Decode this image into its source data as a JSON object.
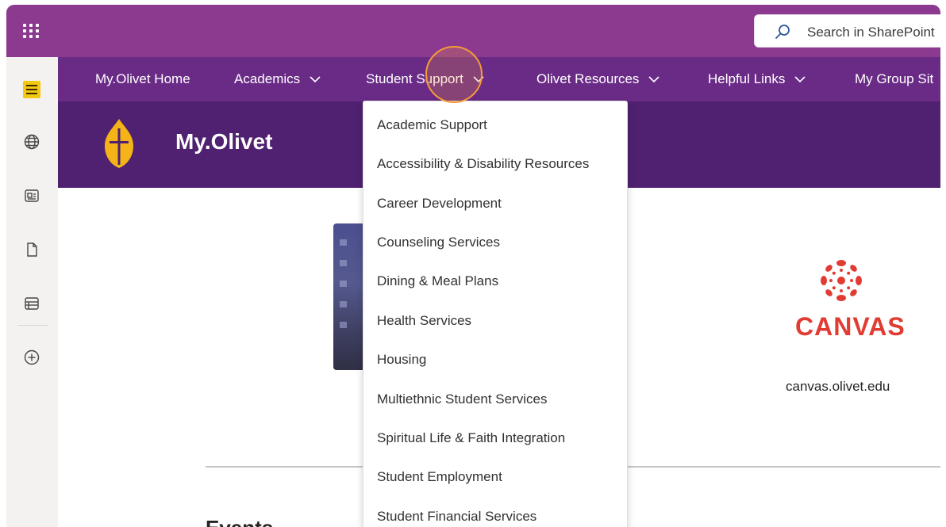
{
  "suitebar": {
    "search_placeholder": "Search in SharePoint"
  },
  "hubnav": {
    "items": [
      {
        "label": "My.Olivet Home"
      },
      {
        "label": "Academics"
      },
      {
        "label": "Student Support"
      },
      {
        "label": "Olivet Resources"
      },
      {
        "label": "Helpful Links"
      },
      {
        "label": "My Group Sit"
      }
    ]
  },
  "header": {
    "title": "My.Olivet"
  },
  "dropdown": {
    "items": [
      "Academic Support",
      "Accessibility & Disability Resources",
      "Career Development",
      "Counseling Services",
      "Dining & Meal Plans",
      "Health Services",
      "Housing",
      "Multiethnic Student Services",
      "Spiritual Life & Faith Integration",
      "Student Employment",
      "Student Financial Services"
    ]
  },
  "content": {
    "canvas_word": "CANVAS",
    "canvas_url": "canvas.olivet.edu",
    "events_heading": "Events"
  },
  "colors": {
    "suitebar": "#8b3a8f",
    "hubnav": "#6a2b87",
    "header": "#4f2170",
    "canvas_red": "#e13c33",
    "cursor_highlight": "#f59a3b"
  },
  "icons": {
    "appbar": [
      "hamburger-icon",
      "globe-icon",
      "news-icon",
      "document-icon",
      "list-icon",
      "add-circle-icon"
    ],
    "search": "search-icon",
    "launcher": "waffle-icon"
  }
}
